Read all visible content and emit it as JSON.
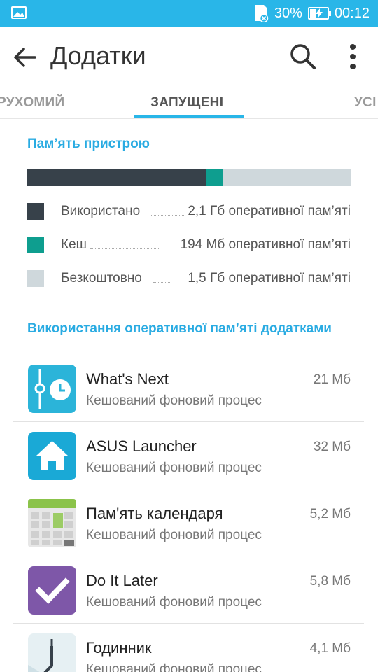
{
  "status_bar": {
    "battery": "30%",
    "time": "00:12",
    "icons": [
      "image-notification-icon",
      "sim-card-icon",
      "battery-charging-icon"
    ]
  },
  "app_bar": {
    "title": "Додатки",
    "icons": [
      "back-arrow-icon",
      "search-icon",
      "more-vert-icon"
    ]
  },
  "tabs": {
    "left": "РУХОМИЙ",
    "active": "ЗАПУЩЕНІ",
    "right": "УСІ"
  },
  "device_memory": {
    "title": "Пам’ять пристрою",
    "bar_fractions": {
      "used": 0.555,
      "cache": 0.048,
      "free": 0.397
    },
    "colors": {
      "used": "#37414a",
      "cache": "#0e9e8f",
      "free": "#cfd8dc"
    },
    "legend": [
      {
        "label": "Використано",
        "value": "2,1 Гб оперативної пам’яті"
      },
      {
        "label": "Кеш",
        "value": "194 Мб оперативної пам’яті"
      },
      {
        "label": "Безкоштовно",
        "value": "1,5 Гб оперативної пам’яті"
      }
    ]
  },
  "apps_section": {
    "title": "Використання оперативної пам’яті додатками",
    "apps": [
      {
        "name": "What's Next",
        "status": "Кешований фоновий процес",
        "size": "21 Мб",
        "icon": "whats-next-icon"
      },
      {
        "name": "ASUS Launcher",
        "status": "Кешований фоновий процес",
        "size": "32 Мб",
        "icon": "home-icon"
      },
      {
        "name": "Пам'ять календаря",
        "status": "Кешований фоновий процес",
        "size": "5,2 Мб",
        "icon": "calendar-storage-icon"
      },
      {
        "name": "Do It Later",
        "status": "Кешований фоновий процес",
        "size": "5,8 Мб",
        "icon": "checkmark-icon"
      },
      {
        "name": "Годинник",
        "status": "Кешований фоновий процес",
        "size": "4,1 Мб",
        "icon": "clock-icon"
      }
    ]
  },
  "accent_color": "#29b6e8"
}
